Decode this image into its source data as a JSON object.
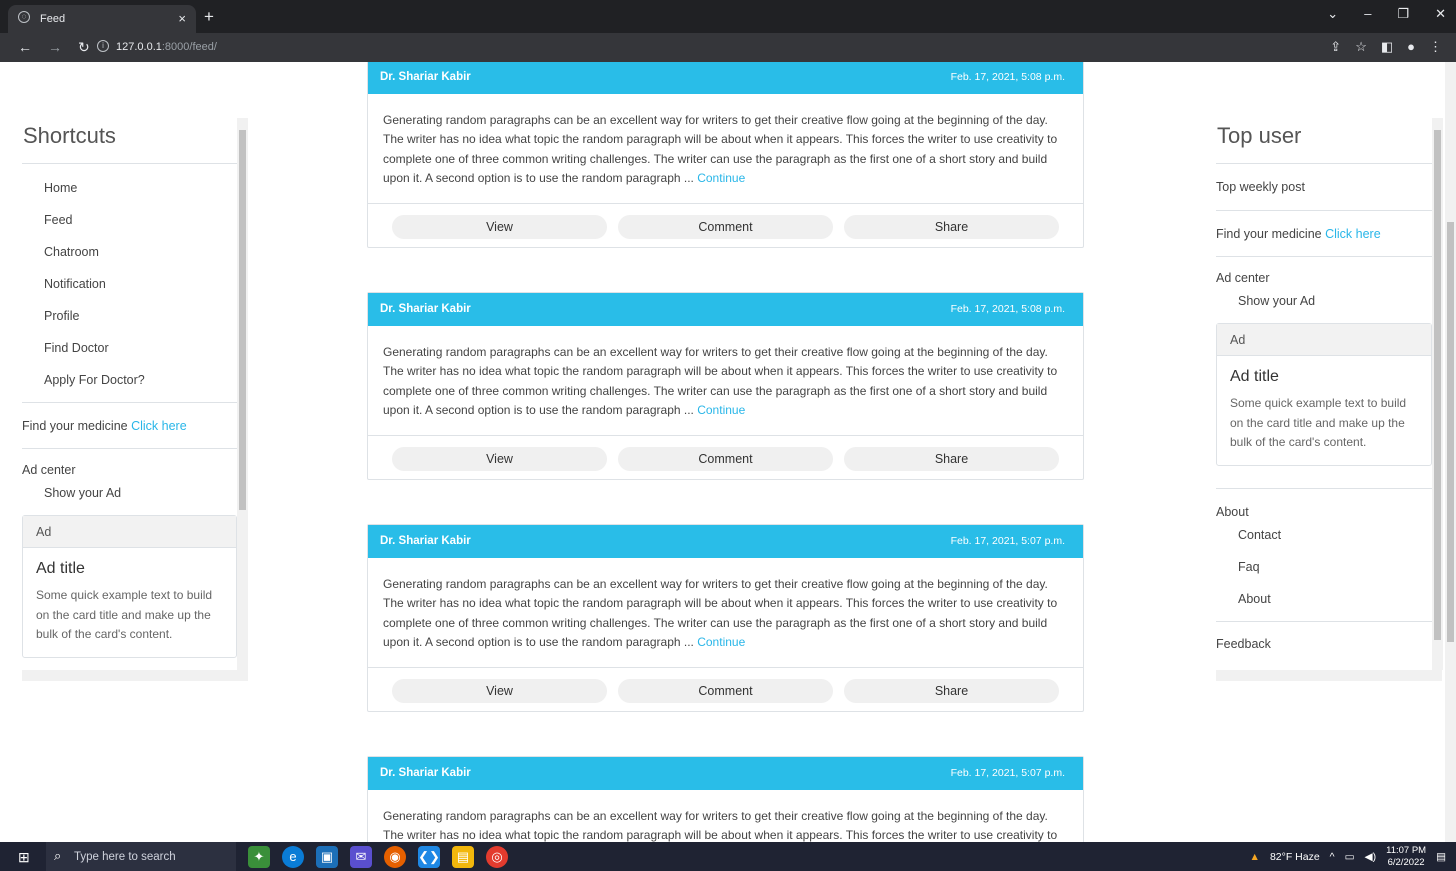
{
  "browser": {
    "tab_title": "Feed",
    "tab_close": "×",
    "new_tab": "+",
    "url_host": "127.0.0.1",
    "url_rest": ":8000/feed/",
    "window_buttons": [
      "⌄",
      "–",
      "❐",
      "✕"
    ]
  },
  "left_sidebar": {
    "title": "Shortcuts",
    "items": [
      "Home",
      "Feed",
      "Chatroom",
      "Notification",
      "Profile",
      "Find Doctor",
      "Apply For Doctor?"
    ],
    "medicine_text": "Find your medicine ",
    "medicine_link": "Click here",
    "ad_center": "Ad center",
    "show_ad": "Show your Ad",
    "ad": {
      "header": "Ad",
      "title": "Ad title",
      "text": "Some quick example text to build on the card title and make up the bulk of the card's content."
    }
  },
  "right_sidebar": {
    "title": "Top user",
    "top_weekly": "Top weekly post",
    "medicine_text": "Find your medicine ",
    "medicine_link": "Click here",
    "ad_center": "Ad center",
    "show_ad": "Show your Ad",
    "ad": {
      "header": "Ad",
      "title": "Ad title",
      "text": "Some quick example text to build on the card title and make up the bulk of the card's content."
    },
    "about": "About",
    "about_items": [
      "Contact",
      "Faq",
      "About"
    ],
    "feedback": "Feedback"
  },
  "posts": [
    {
      "author": "Dr. Shariar Kabir",
      "time": "Feb. 17, 2021, 5:08 p.m.",
      "body": "Generating random paragraphs can be an excellent way for writers to get their creative flow going at the beginning of the day. The writer has no idea what topic the random paragraph will be about when it appears. This forces the writer to use creativity to complete one of three common writing challenges. The writer can use the paragraph as the first one of a short story and build upon it. A second option is to use the random paragraph ... ",
      "more": "Continue"
    },
    {
      "author": "Dr. Shariar Kabir",
      "time": "Feb. 17, 2021, 5:08 p.m.",
      "body": "Generating random paragraphs can be an excellent way for writers to get their creative flow going at the beginning of the day. The writer has no idea what topic the random paragraph will be about when it appears. This forces the writer to use creativity to complete one of three common writing challenges. The writer can use the paragraph as the first one of a short story and build upon it. A second option is to use the random paragraph ... ",
      "more": "Continue"
    },
    {
      "author": "Dr. Shariar Kabir",
      "time": "Feb. 17, 2021, 5:07 p.m.",
      "body": "Generating random paragraphs can be an excellent way for writers to get their creative flow going at the beginning of the day. The writer has no idea what topic the random paragraph will be about when it appears. This forces the writer to use creativity to complete one of three common writing challenges. The writer can use the paragraph as the first one of a short story and build upon it. A second option is to use the random paragraph ... ",
      "more": "Continue"
    },
    {
      "author": "Dr. Shariar Kabir",
      "time": "Feb. 17, 2021, 5:07 p.m.",
      "body": "Generating random paragraphs can be an excellent way for writers to get their creative flow going at the beginning of the day. The writer has no idea what topic the random paragraph will be about when it appears. This forces the writer to use creativity to",
      "more": ""
    }
  ],
  "post_actions": {
    "view": "View",
    "comment": "Comment",
    "share": "Share"
  },
  "taskbar": {
    "search_placeholder": "Type here to search",
    "weather": "82°F Haze",
    "time": "11:07 PM",
    "date": "6/2/2022"
  },
  "colors": {
    "accent": "#29bde8",
    "link": "#29b6e8",
    "chrome_dark": "#202124",
    "taskbar": "#1f2333"
  }
}
